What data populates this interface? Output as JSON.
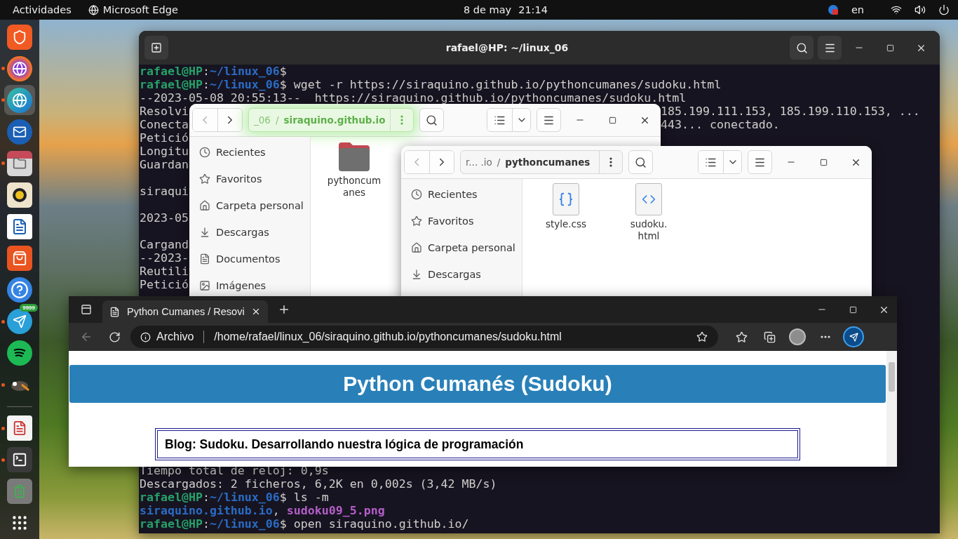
{
  "top_bar": {
    "activities": "Actividades",
    "app_name": "Microsoft Edge",
    "date": "8 de may",
    "time": "21:14",
    "language": "en"
  },
  "dock": [
    {
      "kind": "app",
      "running": false,
      "selected": false
    },
    {
      "kind": "app",
      "running": true,
      "selected": false
    },
    {
      "kind": "app",
      "running": true,
      "selected": true
    },
    {
      "kind": "app",
      "running": false,
      "selected": false
    },
    {
      "kind": "app",
      "running": true,
      "selected": false
    },
    {
      "kind": "app",
      "running": false,
      "selected": false
    },
    {
      "kind": "app",
      "running": false,
      "selected": false
    },
    {
      "kind": "app",
      "running": false,
      "selected": false
    },
    {
      "kind": "app",
      "running": false,
      "selected": false
    },
    {
      "kind": "app",
      "running": true,
      "selected": false,
      "badge": "9999"
    },
    {
      "kind": "app",
      "running": false,
      "selected": false
    },
    {
      "kind": "app",
      "running": true,
      "selected": false
    },
    {
      "kind": "separator"
    },
    {
      "kind": "app",
      "running": true,
      "selected": false
    },
    {
      "kind": "app",
      "running": true,
      "selected": false
    },
    {
      "kind": "app",
      "running": false,
      "selected": false
    },
    {
      "kind": "grid",
      "running": false,
      "selected": false
    }
  ],
  "terminal": {
    "title": "rafael@HP: ~/linux_06",
    "top_lines": [
      {
        "kind": "prompt",
        "user": "rafael@HP",
        "colon": ":",
        "path": "~/linux_06",
        "sign": "$"
      },
      {
        "kind": "prompt",
        "user": "rafael@HP",
        "colon": ":",
        "path": "~/linux_06",
        "sign": "$",
        "command": "wget -r https://siraquino.github.io/pythoncumanes/sudoku.html"
      },
      {
        "kind": "output",
        "text": "--2023-05-08 20:55:13--  https://siraquino.github.io/pythoncumanes/sudoku.html"
      },
      {
        "kind": "output",
        "text": "Resolvi",
        "right": "185.199.111.153, 185.199.110.153, ..."
      },
      {
        "kind": "output",
        "text": "Conecta",
        "right": "443... conectado."
      },
      {
        "kind": "output",
        "text": "Petició"
      },
      {
        "kind": "output",
        "text": "Longitu"
      },
      {
        "kind": "output",
        "text": "Guardan"
      },
      {
        "kind": "blank"
      },
      {
        "kind": "output",
        "text": "siraqui"
      },
      {
        "kind": "blank"
      },
      {
        "kind": "output",
        "text": "2023-05"
      },
      {
        "kind": "blank"
      },
      {
        "kind": "output",
        "text": "Cargand"
      },
      {
        "kind": "output",
        "text": "--2023-"
      },
      {
        "kind": "output",
        "text": "Reutili"
      },
      {
        "kind": "output",
        "text": "Petició"
      }
    ],
    "bottom_lines": [
      {
        "kind": "output",
        "text": "Tiempo total de reloj: 0,9s"
      },
      {
        "kind": "output",
        "text": "Descargados: 2 ficheros, 6,2K en 0,002s (3,42 MB/s)"
      },
      {
        "kind": "prompt",
        "user": "rafael@HP",
        "colon": ":",
        "path": "~/linux_06",
        "sign": "$",
        "command": "ls -m"
      },
      {
        "kind": "listing",
        "items": [
          {
            "name": "siraquino.github.io",
            "separator": ",",
            "color": "#2a6cc4"
          },
          {
            "name": "sudoku09_5.png",
            "color": "#b45ec8"
          }
        ]
      },
      {
        "kind": "prompt",
        "user": "rafael@HP",
        "colon": ":",
        "path": "~/linux_06",
        "sign": "$",
        "command": "open siraquino.github.io/"
      }
    ]
  },
  "file_windows": [
    {
      "path_prefix": "_06",
      "path_sep": "/",
      "path_current": "siraquino.github.io",
      "highlighted": true,
      "sidebar": [
        {
          "label": "Recientes",
          "kind": "recent"
        },
        {
          "label": "Favoritos",
          "kind": "starred"
        },
        {
          "label": "Carpeta personal",
          "kind": "home"
        },
        {
          "label": "Descargas",
          "kind": "downloads"
        },
        {
          "label": "Documentos",
          "kind": "documents"
        },
        {
          "label": "Imágenes",
          "kind": "pictures"
        }
      ],
      "files": [
        {
          "name": "pythoncumanes",
          "kind": "folder"
        }
      ]
    },
    {
      "path_prefix": "r... .io",
      "path_sep": "/",
      "path_current": "pythoncumanes",
      "highlighted": false,
      "sidebar": [
        {
          "label": "Recientes",
          "kind": "recent"
        },
        {
          "label": "Favoritos",
          "kind": "starred"
        },
        {
          "label": "Carpeta personal",
          "kind": "home"
        },
        {
          "label": "Descargas",
          "kind": "downloads"
        }
      ],
      "files": [
        {
          "name": "style.css",
          "kind": "css"
        },
        {
          "name": "sudoku.html",
          "kind": "html"
        }
      ]
    }
  ],
  "browser": {
    "tab_title": "Python Cumanes / Resovi",
    "address_label": "Archivo",
    "url": "/home/rafael/linux_06/siraquino.github.io/pythoncumanes/sudoku.html",
    "page_heading": "Python Cumanés (Sudoku)",
    "blog_title": "Blog: Sudoku. Desarrollando nuestra lógica de programación"
  }
}
